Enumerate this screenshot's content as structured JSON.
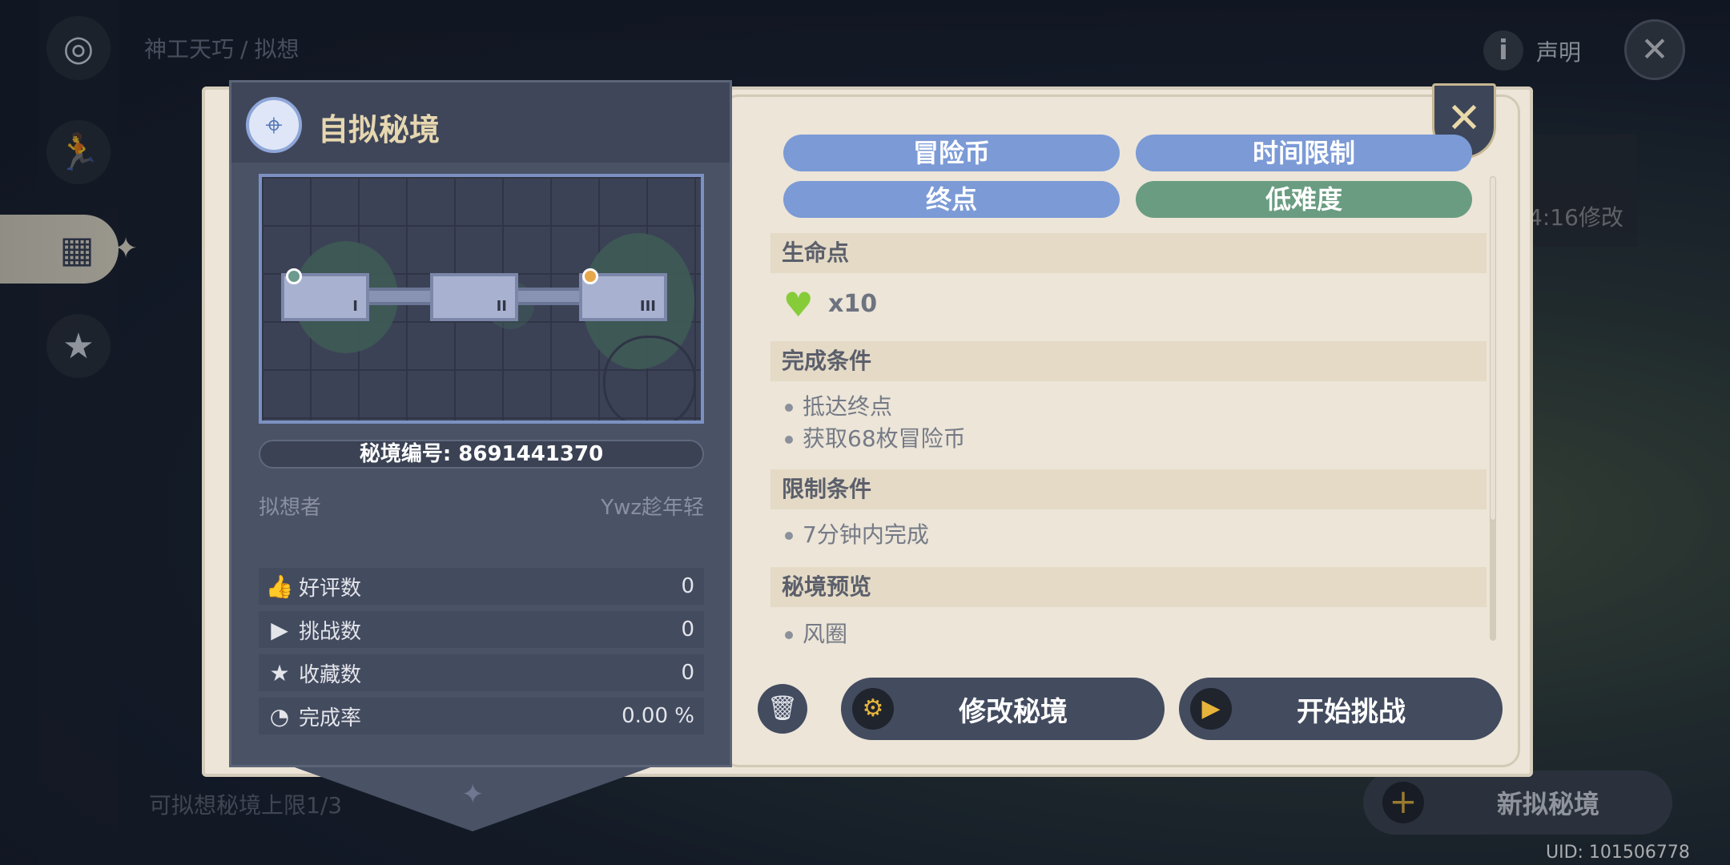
{
  "breadcrumb": {
    "root": "神工天巧",
    "separator": "/",
    "current": "拟想"
  },
  "top_bar": {
    "info_glyph": "i",
    "declaration_label": "声明"
  },
  "background": {
    "modified_time": "4:16修改",
    "quota_text": "可拟想秘境上限1/3",
    "new_domain_label": "新拟秘境",
    "uid": "UID: 101506778"
  },
  "left_panel": {
    "title": "自拟秘境",
    "domain_code": "秘境编号: 8691441370",
    "author_label": "拟想者",
    "author_name": "Ywz趁年轻",
    "room_numbers": [
      "I",
      "II",
      "III"
    ],
    "stats": [
      {
        "icon": "thumbs-up-icon",
        "label": "好评数",
        "value": "0"
      },
      {
        "icon": "play-icon",
        "label": "挑战数",
        "value": "0"
      },
      {
        "icon": "star-icon",
        "label": "收藏数",
        "value": "0"
      },
      {
        "icon": "pie-icon",
        "label": "完成率",
        "value": "0.00 %"
      }
    ]
  },
  "tags": [
    {
      "label": "冒险币",
      "color": "#7b9ad6"
    },
    {
      "label": "时间限制",
      "color": "#7b9ad6"
    },
    {
      "label": "终点",
      "color": "#7b9ad6"
    },
    {
      "label": "低难度",
      "color": "#6a9c81"
    }
  ],
  "sections": {
    "hp": {
      "title": "生命点",
      "value": "x10"
    },
    "completion": {
      "title": "完成条件",
      "items": [
        "抵达终点",
        "获取68枚冒险币"
      ]
    },
    "limit": {
      "title": "限制条件",
      "items": [
        "7分钟内完成"
      ]
    },
    "preview": {
      "title": "秘境预览",
      "items": [
        "风圈"
      ]
    }
  },
  "actions": {
    "edit_label": "修改秘境",
    "start_label": "开始挑战"
  }
}
